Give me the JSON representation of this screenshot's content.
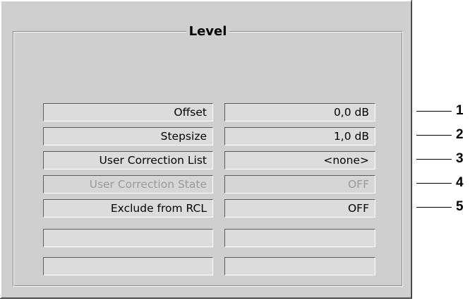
{
  "level_group": {
    "title": "Level",
    "rows": [
      {
        "label": "Offset",
        "value": "0,0 dB",
        "enabled": true,
        "callout": "1"
      },
      {
        "label": "Stepsize",
        "value": "1,0 dB",
        "enabled": true,
        "callout": "2"
      },
      {
        "label": "User Correction List",
        "value": "<none>",
        "enabled": true,
        "callout": "3"
      },
      {
        "label": "User Correction State",
        "value": "OFF",
        "enabled": false,
        "callout": "4"
      },
      {
        "label": "Exclude from RCL",
        "value": "OFF",
        "enabled": true,
        "callout": "5"
      },
      {
        "label": "",
        "value": "",
        "enabled": true,
        "callout": ""
      },
      {
        "label": "",
        "value": "",
        "enabled": true,
        "callout": ""
      }
    ]
  }
}
